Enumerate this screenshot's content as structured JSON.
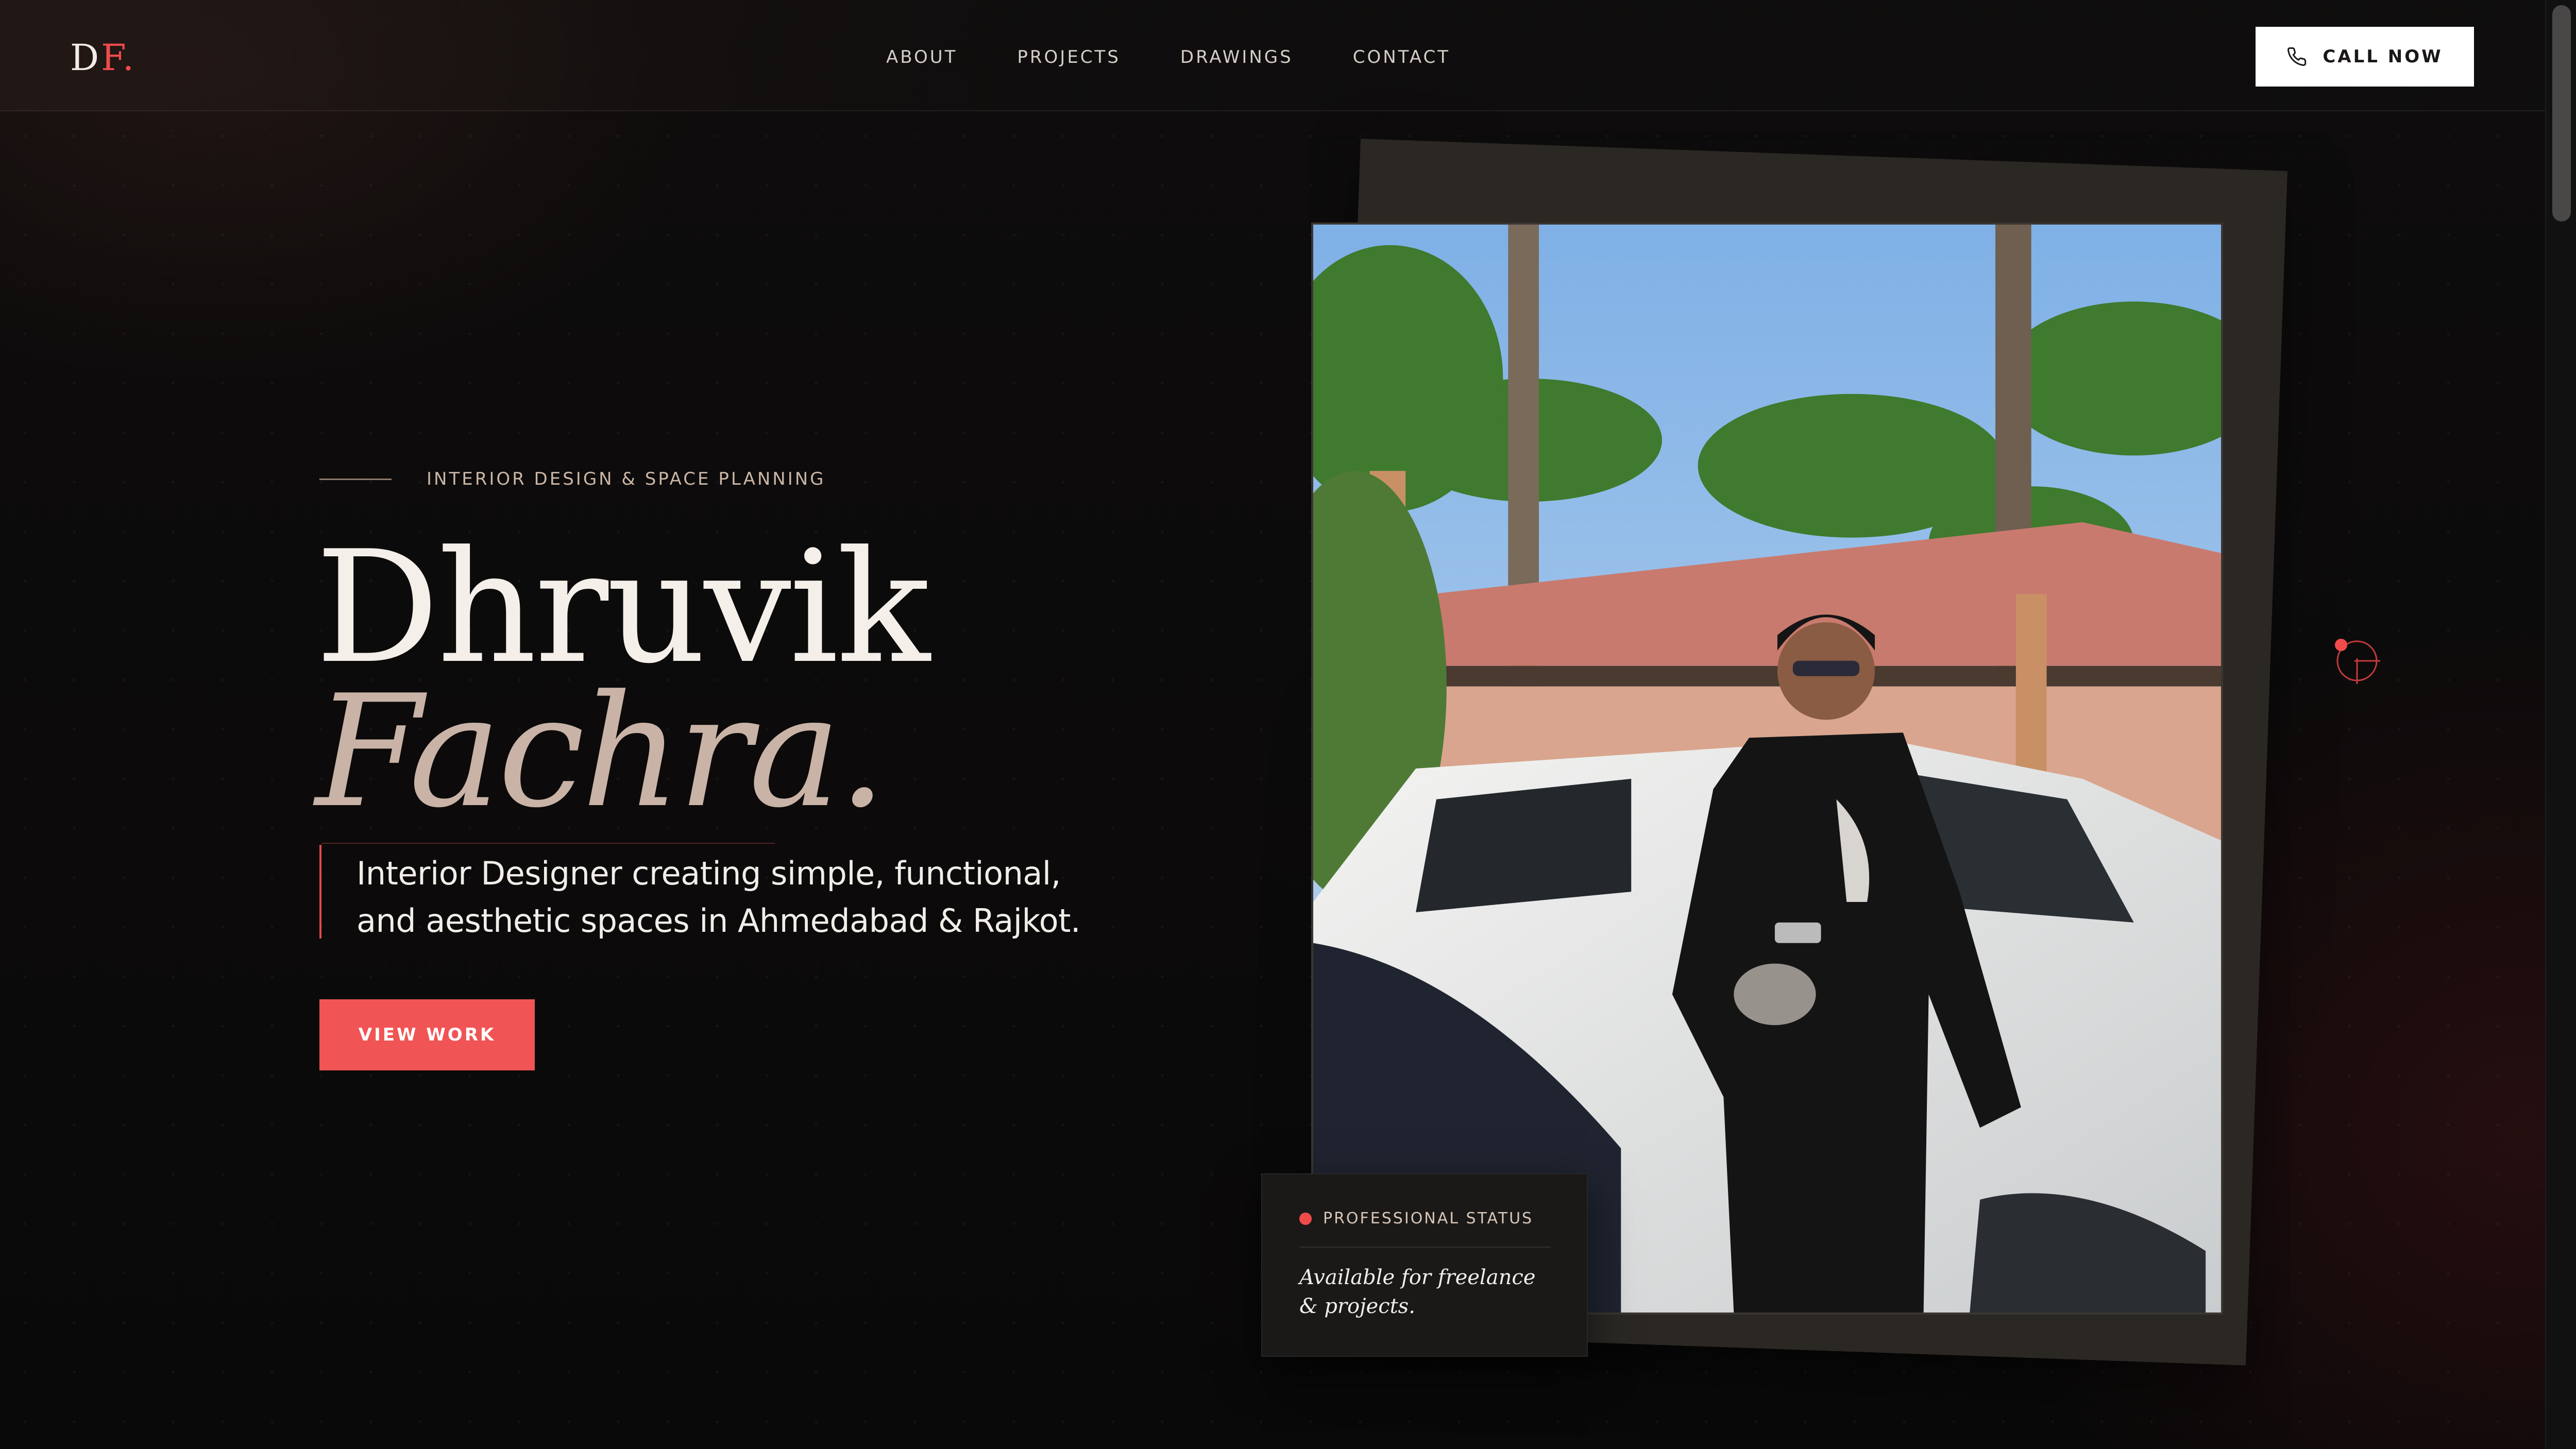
{
  "header": {
    "logo_main": "D",
    "logo_accent": "F.",
    "nav": [
      "ABOUT",
      "PROJECTS",
      "DRAWINGS",
      "CONTACT"
    ],
    "call_label": "CALL NOW",
    "call_icon": "phone-icon"
  },
  "hero": {
    "eyebrow": "INTERIOR DESIGN & SPACE PLANNING",
    "first_name": "Dhruvik",
    "last_name": "Fachra.",
    "tagline": "Interior Designer creating simple, functional, and aesthetic spaces in Ahmedabad & Rajkot.",
    "cta_label": "VIEW WORK"
  },
  "status": {
    "label": "PROFESSIONAL STATUS",
    "text": "Available for freelance & projects."
  },
  "colors": {
    "accent": "#ef4b4b",
    "background": "#0b0a0a",
    "muted_beige": "#c9b3a6"
  }
}
